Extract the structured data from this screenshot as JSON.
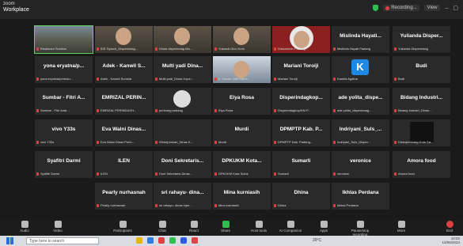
{
  "window": {
    "app_small": "zoom",
    "app_name": "Workplace"
  },
  "header": {
    "recording_label": "Recording...",
    "view_label": "View"
  },
  "tiles": [
    {
      "name": "",
      "tag": "Risalmam Sumbar",
      "kind": "video-room"
    },
    {
      "name": "",
      "tag": "IDE Syarch_Disperindag...",
      "kind": "video-dark"
    },
    {
      "name": "",
      "tag": "Dinas disperindag Ma...",
      "kind": "video-dark"
    },
    {
      "name": "",
      "tag": "Yukandi Dino Kom",
      "kind": "video-dark"
    },
    {
      "name": "",
      "tag": "Diskominfo Padang...",
      "kind": "video-hijab"
    },
    {
      "name": "Mislinda Hayati...",
      "tag": "Mislinda Hayati Padang",
      "kind": "name"
    },
    {
      "name": "Yulianda Disper...",
      "tag": "Yulianda Disperindag",
      "kind": "name"
    },
    {
      "name": "yona eryatna/p...",
      "tag": "yona eryatna/perindu...",
      "kind": "name"
    },
    {
      "name": "Adek - Kanwil S...",
      "tag": "Adek - Kanwil Sumbar",
      "kind": "name"
    },
    {
      "name": "Multi yadi Dina...",
      "tag": "Multi yadi_Dinas Kope...",
      "kind": "name"
    },
    {
      "name": "",
      "tag": "Ir. Hanan, MM Kandi...",
      "kind": "video-person"
    },
    {
      "name": "Mariani Toroiji",
      "tag": "Mariani Toroiji",
      "kind": "name"
    },
    {
      "name": "",
      "tag": "Kamila Agatha",
      "kind": "k-badge"
    },
    {
      "name": "Budi",
      "tag": "Budi",
      "kind": "name"
    },
    {
      "name": "Sumbar - Fitri A...",
      "tag": "Sumbar - Fitri Andr...",
      "kind": "name"
    },
    {
      "name": "EMRIZAL PERIN...",
      "tag": "EMRIZAL PERINDAGH...",
      "kind": "name"
    },
    {
      "name": "",
      "tag": "perindag kabdag",
      "kind": "avatar"
    },
    {
      "name": "Elya Rosa",
      "tag": "Elya Rosa",
      "kind": "name"
    },
    {
      "name": "Disperindagkop...",
      "tag": "Disperindagkop/KM P...",
      "kind": "name"
    },
    {
      "name": "ade yolita_dispe...",
      "tag": "ade yolita_disperinaag...",
      "kind": "name"
    },
    {
      "name": "Bidang Industri...",
      "tag": "Bidang Industri_Dinas...",
      "kind": "name"
    },
    {
      "name": "vivo Y33s",
      "tag": "vivo Y33s",
      "kind": "name"
    },
    {
      "name": "Eva Walni Dinas...",
      "tag": "Eva Walni Dinas Perin...",
      "kind": "name"
    },
    {
      "name": "",
      "tag": "Wiradj Askari_Dinas K...",
      "kind": "name"
    },
    {
      "name": "Murdi",
      "tag": "Murdi",
      "kind": "name"
    },
    {
      "name": "DPMPTP Kab. P...",
      "tag": "DPMPTP Kab. Padang...",
      "kind": "name"
    },
    {
      "name": "Indriyani_Suls_...",
      "tag": "Indriyani_Suls_Disper...",
      "kind": "name"
    },
    {
      "name": "",
      "tag": "Diskoperindag Kota Sa...",
      "kind": "dark-square"
    },
    {
      "name": "Syafitri Darmi",
      "tag": "Syafitri Darmi",
      "kind": "name"
    },
    {
      "name": "ILEN",
      "tag": "ILEN",
      "kind": "name"
    },
    {
      "name": "Doni Sekretaris...",
      "tag": "Doni Sekretaris Dinas...",
      "kind": "name"
    },
    {
      "name": "DPKUKM Kota...",
      "tag": "DPKUKM Kota Solok",
      "kind": "name"
    },
    {
      "name": "Sumarli",
      "tag": "Sumarli",
      "kind": "name"
    },
    {
      "name": "veronice",
      "tag": "veronice",
      "kind": "name"
    },
    {
      "name": "Amora food",
      "tag": "Amora food",
      "kind": "name"
    },
    {
      "name": "Pearly nurhasnah",
      "tag": "Pearly nurhasnah",
      "kind": "name"
    },
    {
      "name": "sri rahayu- dina...",
      "tag": "sri rahayu- dinas inpe...",
      "kind": "name"
    },
    {
      "name": "Mina kurniasih",
      "tag": "Mina kurniasih",
      "kind": "name"
    },
    {
      "name": "Dhina",
      "tag": "Dhina",
      "kind": "name"
    },
    {
      "name": "Ikhlas Perdana",
      "tag": "Ikhlas Perdana",
      "kind": "name"
    }
  ],
  "toolbar": {
    "audio": "Audio",
    "video": "Video",
    "participants": "Participants",
    "chat": "Chat",
    "react": "React",
    "share": "Share",
    "host_tools": "Host tools",
    "ai_companion": "AI Companion",
    "apps": "Apps",
    "pause_recording": "Pause/stop recording",
    "more": "More",
    "end": "End",
    "participants_count": "40",
    "colors": {
      "share": "#2fbf4f",
      "end": "#e04040"
    }
  },
  "taskbar": {
    "search_placeholder": "Type here to search",
    "weather": "29°C",
    "time": "10:02",
    "date": "13/06/2024"
  }
}
